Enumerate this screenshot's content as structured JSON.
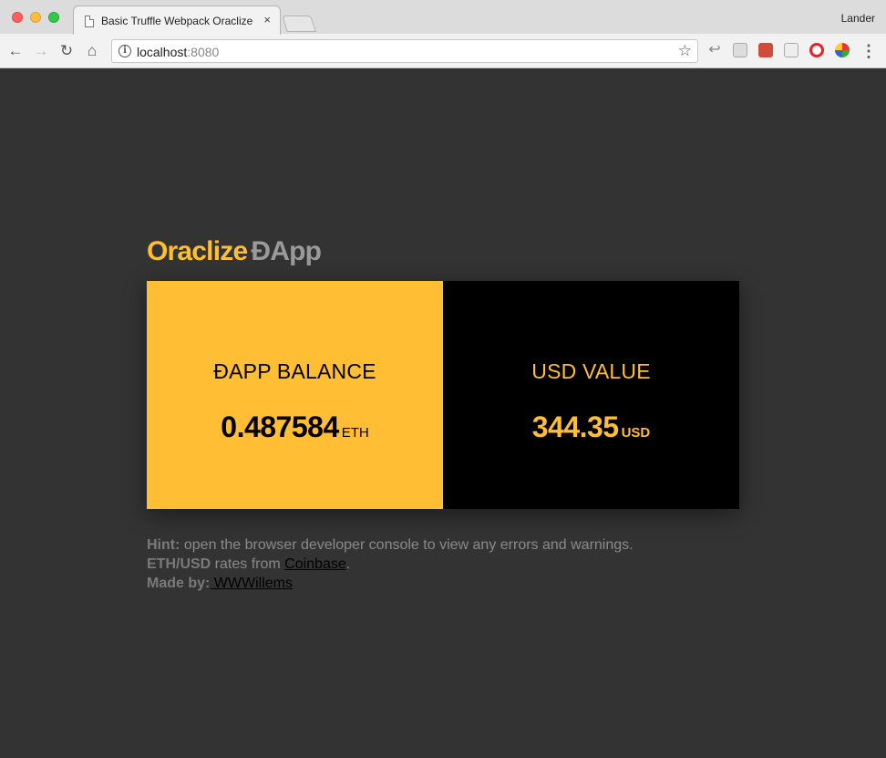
{
  "browser": {
    "tab_title": "Basic Truffle Webpack Oraclize",
    "tab_close": "×",
    "profile_name": "Lander",
    "url_host": "localhost",
    "url_port": ":8080"
  },
  "app": {
    "title_primary": "Oraclize",
    "title_secondary": "ĐApp"
  },
  "balance": {
    "label": "ĐAPP BALANCE",
    "value": "0.487584",
    "unit": "ETH"
  },
  "usd": {
    "label": "USD VALUE",
    "value": "344.35",
    "unit": "USD"
  },
  "notes": {
    "hint_label": "Hint:",
    "hint_text": " open the browser developer console to view any errors and warnings.",
    "rates_label": "ETH/USD",
    "rates_text": " rates from ",
    "rates_link": "Coinbase",
    "rates_end": ".",
    "made_label": "Made by:",
    "made_link": " WWWillems"
  },
  "colors": {
    "accent": "#ffbe33",
    "background": "#333333",
    "panel_dark": "#000000"
  },
  "icons": [
    "back-arrow-icon",
    "forward-arrow-icon",
    "reload-icon",
    "home-icon",
    "info-icon",
    "star-icon",
    "menu-icon"
  ]
}
